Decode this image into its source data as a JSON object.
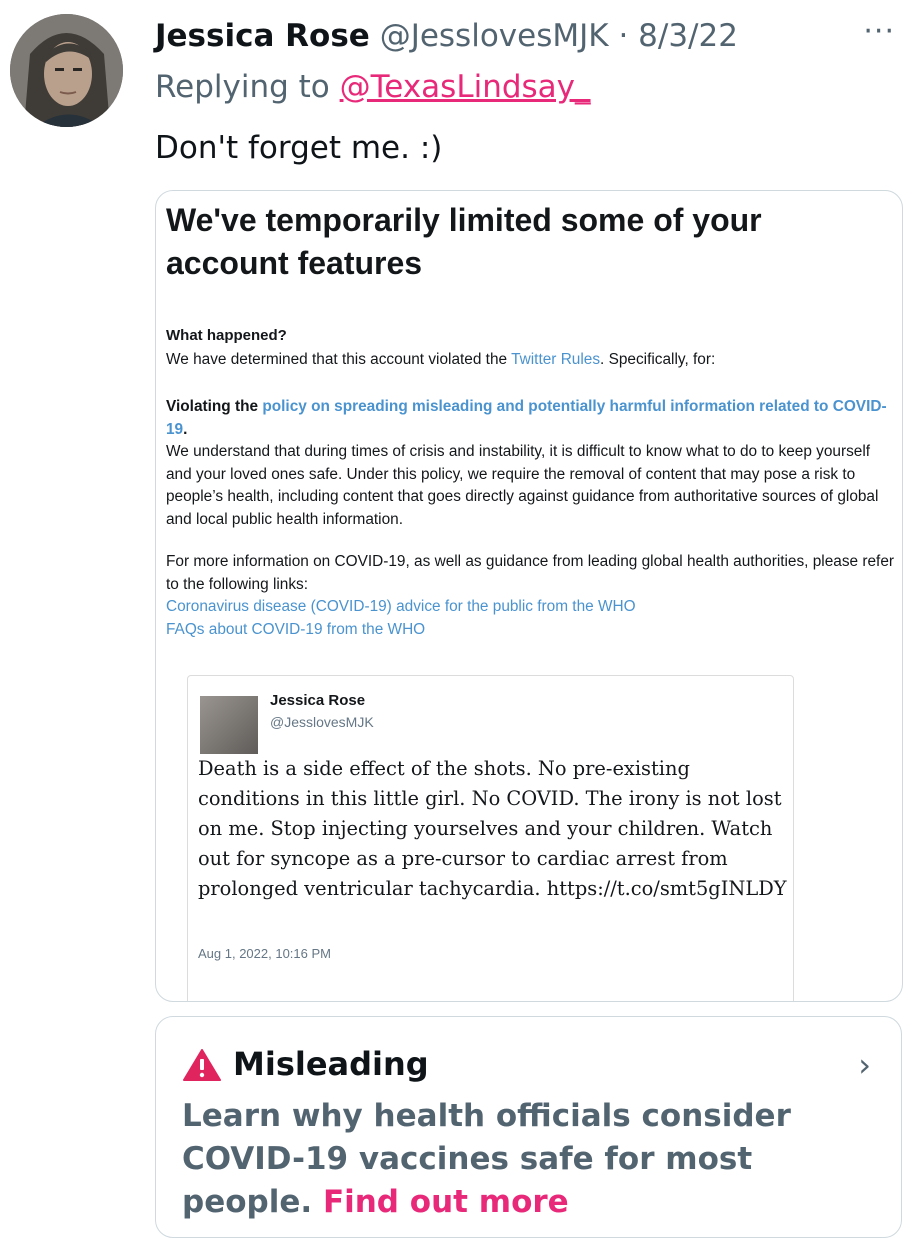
{
  "tweet": {
    "author_name": "Jessica Rose",
    "author_handle": "@JesslovesMJK",
    "separator": "·",
    "date": "8/3/22",
    "more": "···",
    "replying_prefix": "Replying to ",
    "replying_handle": "@TexasLindsay_",
    "text": "Don't forget me. :)"
  },
  "screenshot": {
    "title": "We've temporarily limited some of your account features",
    "what_happened_label": "What happened?",
    "determined_prefix": "We have determined that this account violated the ",
    "twitter_rules_link": "Twitter Rules",
    "determined_suffix": ". Specifically, for:",
    "violating_prefix": "Violating the ",
    "policy_link": "policy on spreading misleading and potentially harmful information related to COVID-19",
    "period": ".",
    "policy_text": "We understand that during times of crisis and instability, it is difficult to know what to do to keep yourself and your loved ones safe. Under this policy, we require the removal of content that may pose a risk to people’s health, including content that goes directly against guidance from authoritative sources of global and local public health information.",
    "more_info_text": "For more information on COVID-19, as well as guidance from leading global health authorities, please refer to the following links:",
    "link1": "Coronavirus disease (COVID-19) advice for the public from the WHO",
    "link2": "FAQs about COVID-19 from the WHO",
    "embedded": {
      "name": "Jessica Rose",
      "handle": "@JesslovesMJK",
      "text": "Death is a side effect of the shots. No pre-existing conditions in this little girl. No COVID. The irony is not lost on me. Stop injecting yourselves and your children. Watch out for syncope as a pre-cursor to cardiac arrest from prolonged ventricular tachycardia. https://t.co/smt5gINLDY",
      "date": "Aug 1, 2022, 10:16 PM"
    }
  },
  "notice": {
    "label": "Misleading",
    "body": "Learn why health officials consider COVID-19 vaccines safe for most people.",
    "link": "Find out more",
    "chevron": "›",
    "warning_color": "#e0245e"
  },
  "colors": {
    "link_pink": "#e8297a",
    "link_blue": "#4a93cf",
    "muted": "#536471"
  }
}
